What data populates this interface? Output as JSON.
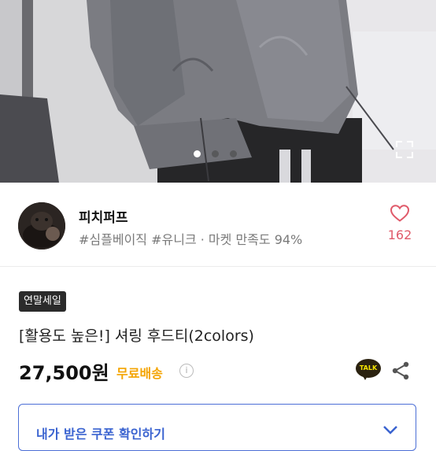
{
  "photo": {
    "slide_count": 3,
    "active_slide": 1,
    "expand_icon": "expand-icon"
  },
  "seller": {
    "name": "피치퍼프",
    "tags": "#심플베이직 #유니크 · 마켓 만족도 94%",
    "like_count": "162",
    "like_icon": "heart-outline-icon",
    "accent_color": "#e05a6a"
  },
  "product": {
    "badge": "연말세일",
    "title": "[활용도 높은!] 셔링 후드티(2colors)",
    "price": "27,500원",
    "shipping": "무료배송",
    "shipping_color": "#f4a400",
    "info_icon": "i"
  },
  "actions": {
    "talk_label": "TALK",
    "share_icon": "share-icon"
  },
  "coupon": {
    "label": "내가 받은 쿠폰 확인하기",
    "color": "#3a63d0"
  }
}
